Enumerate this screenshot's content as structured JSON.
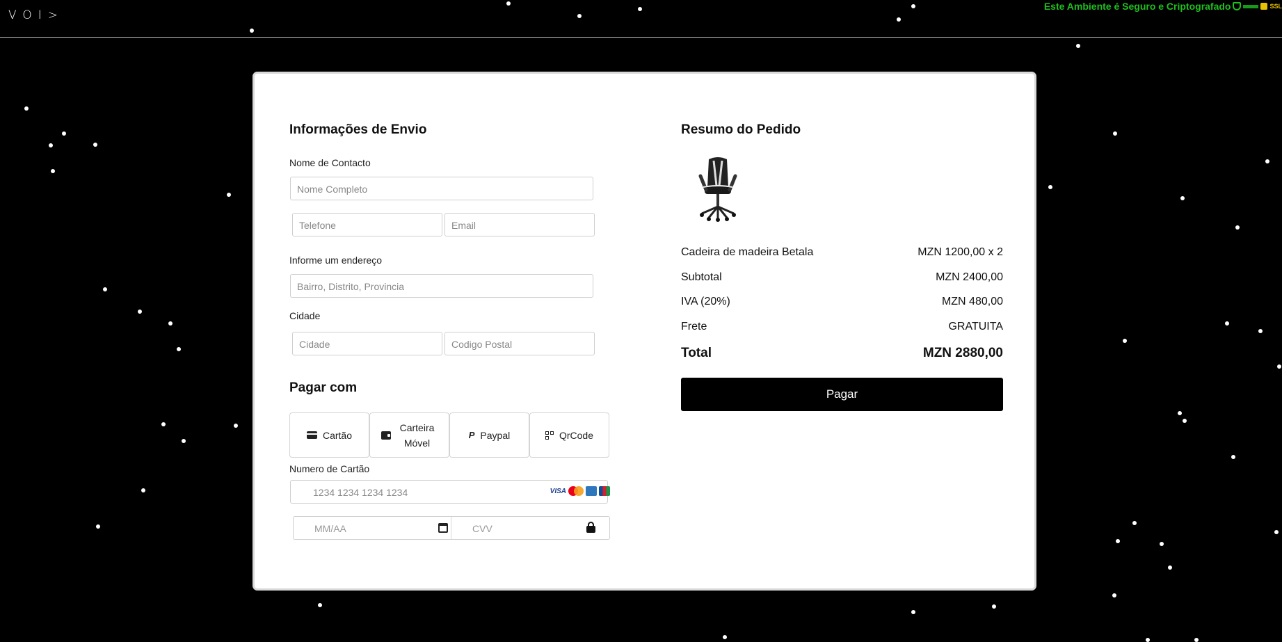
{
  "header": {
    "logo": "VOI>",
    "secure_text": "Este Ambiente é Seguro e Criptografado",
    "ssl": "SSL"
  },
  "shipping": {
    "title": "Informações de Envio",
    "contact_label": "Nome de Contacto",
    "fullname_placeholder": "Nome Completo",
    "phone_placeholder": "Telefone",
    "email_placeholder": "Email",
    "address_label": "Informe um endereço",
    "address_placeholder": "Bairro, Distrito, Provincia",
    "city_label": "Cidade",
    "city_placeholder": "Cidade",
    "postal_placeholder": "Codigo Postal"
  },
  "payment": {
    "title": "Pagar com",
    "options": [
      "Cartão",
      "Carteira Móvel",
      "Paypal",
      "QrCode"
    ],
    "card_number_label": "Numero de Cartão",
    "card_number_placeholder": "1234 1234 1234 1234",
    "brands": [
      "VISA",
      "Mastercard",
      "Amex",
      "JCB"
    ],
    "expiry_placeholder": "MM/AA",
    "cvv_placeholder": "CVV"
  },
  "summary": {
    "title": "Resumo do Pedido",
    "item_name": "Cadeira de madeira Betala",
    "item_price": "MZN 1200,00 x 2",
    "subtotal_label": "Subtotal",
    "subtotal_value": "MZN 2400,00",
    "tax_label": "IVA (20%)",
    "tax_value": "MZN 480,00",
    "shipping_label": "Frete",
    "shipping_value": "GRATUITA",
    "total_label": "Total",
    "total_value": "MZN 2880,00",
    "pay_button": "Pagar"
  },
  "colors": {
    "background": "#000000",
    "secure_text": "#1fbf1f",
    "button": "#000000"
  }
}
